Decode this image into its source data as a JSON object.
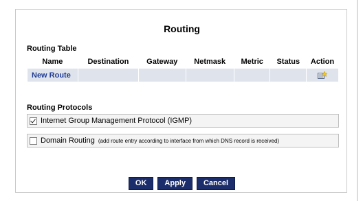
{
  "page": {
    "title": "Routing"
  },
  "routing_table": {
    "label": "Routing Table",
    "columns": [
      "Name",
      "Destination",
      "Gateway",
      "Netmask",
      "Metric",
      "Status",
      "Action"
    ],
    "rows": [
      {
        "name": "New Route",
        "destination": "",
        "gateway": "",
        "netmask": "",
        "metric": "",
        "status": "",
        "action_icon": "add-route-icon"
      }
    ]
  },
  "routing_protocols": {
    "label": "Routing Protocols",
    "items": [
      {
        "label": "Internet Group Management Protocol (IGMP)",
        "note": "",
        "checked": true
      },
      {
        "label": "Domain Routing",
        "note": "(add route entry according to interface from which DNS record is received)",
        "checked": false
      }
    ]
  },
  "buttons": {
    "ok": "OK",
    "apply": "Apply",
    "cancel": "Cancel"
  },
  "colors": {
    "button_bg": "#1b2d6b",
    "row_bg": "#dfe4ec",
    "link": "#1f3a93"
  }
}
